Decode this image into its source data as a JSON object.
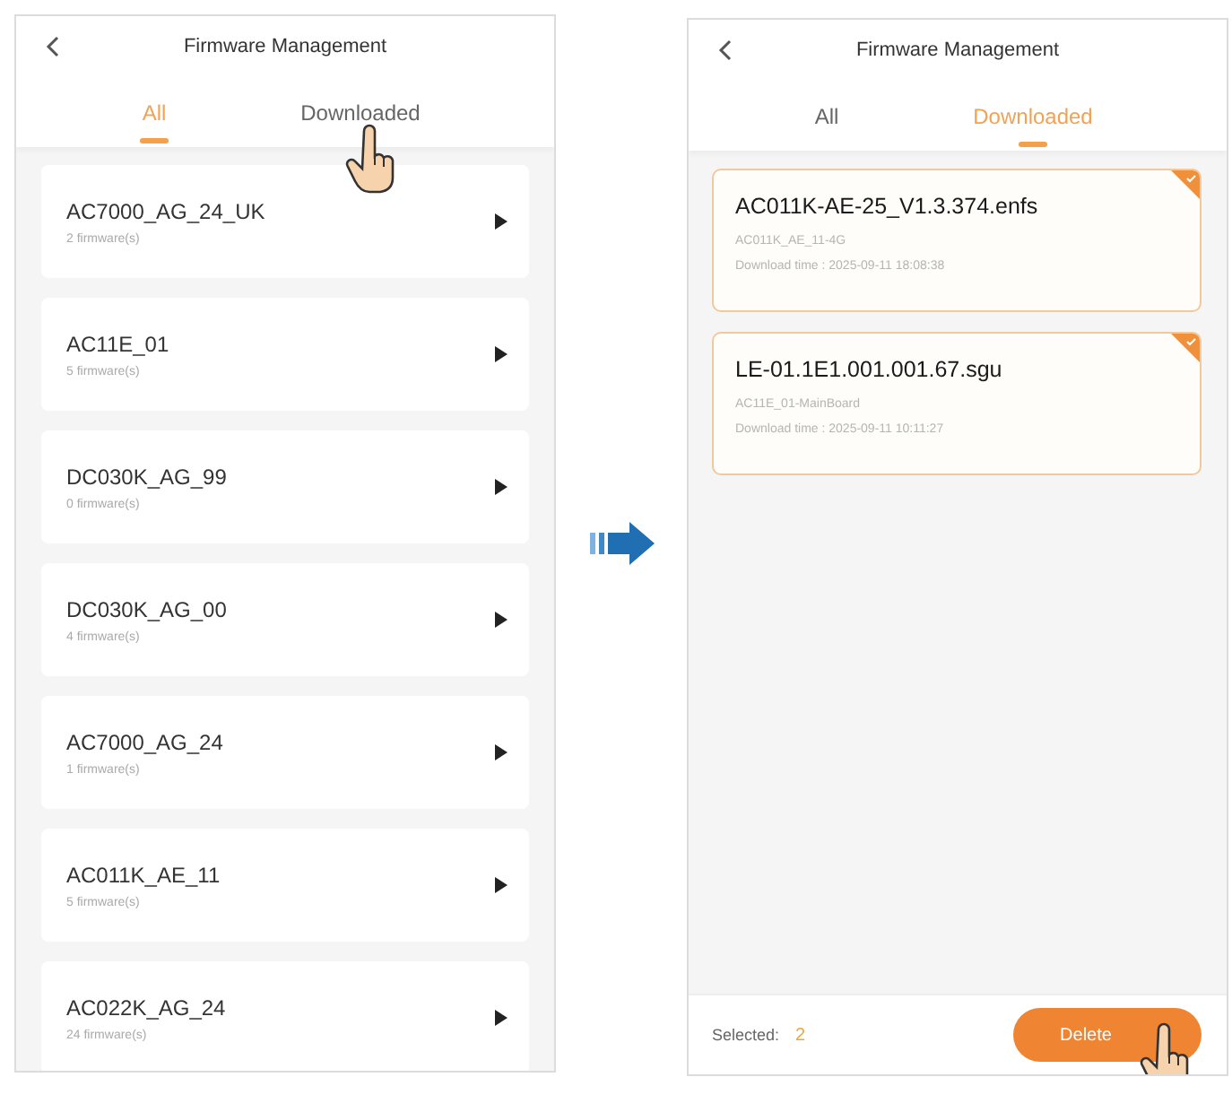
{
  "screens": [
    {
      "kind": "all_firmware",
      "header": {
        "title": "Firmware Management"
      },
      "tabs": [
        {
          "label": "All",
          "selected": true,
          "tapped": false
        },
        {
          "label": "Downloaded",
          "selected": false,
          "tapped": true
        }
      ],
      "models": [
        {
          "name": "AC7000_AG_24_UK",
          "count": "2 firmware(s)"
        },
        {
          "name": "AC11E_01",
          "count": "5 firmware(s)"
        },
        {
          "name": "DC030K_AG_99",
          "count": "0 firmware(s)"
        },
        {
          "name": "DC030K_AG_00",
          "count": "4 firmware(s)"
        },
        {
          "name": "AC7000_AG_24",
          "count": "1 firmware(s)"
        },
        {
          "name": "AC011K_AE_11",
          "count": "5 firmware(s)"
        },
        {
          "name": "AC022K_AG_24",
          "count": "24 firmware(s)"
        }
      ]
    },
    {
      "kind": "downloaded",
      "header": {
        "title": "Firmware Management"
      },
      "tabs": [
        {
          "label": "All",
          "selected": false,
          "tapped": false
        },
        {
          "label": "Downloaded",
          "selected": true,
          "tapped": false
        }
      ],
      "files": [
        {
          "name": "AC011K-AE-25_V1.3.374.enfs",
          "model": "AC011K_AE_11-4G",
          "download_time": "Download time : 2025-09-11 18:08:38",
          "selected": true
        },
        {
          "name": "LE-01.1E1.001.001.67.sgu",
          "model": "AC11E_01-MainBoard",
          "download_time": "Download time : 2025-09-11 10:11:27",
          "selected": true
        }
      ],
      "footer": {
        "selected_label": "Selected:",
        "selected_count": "2",
        "delete_button": {
          "label": "Delete",
          "tapped": true
        }
      }
    }
  ]
}
